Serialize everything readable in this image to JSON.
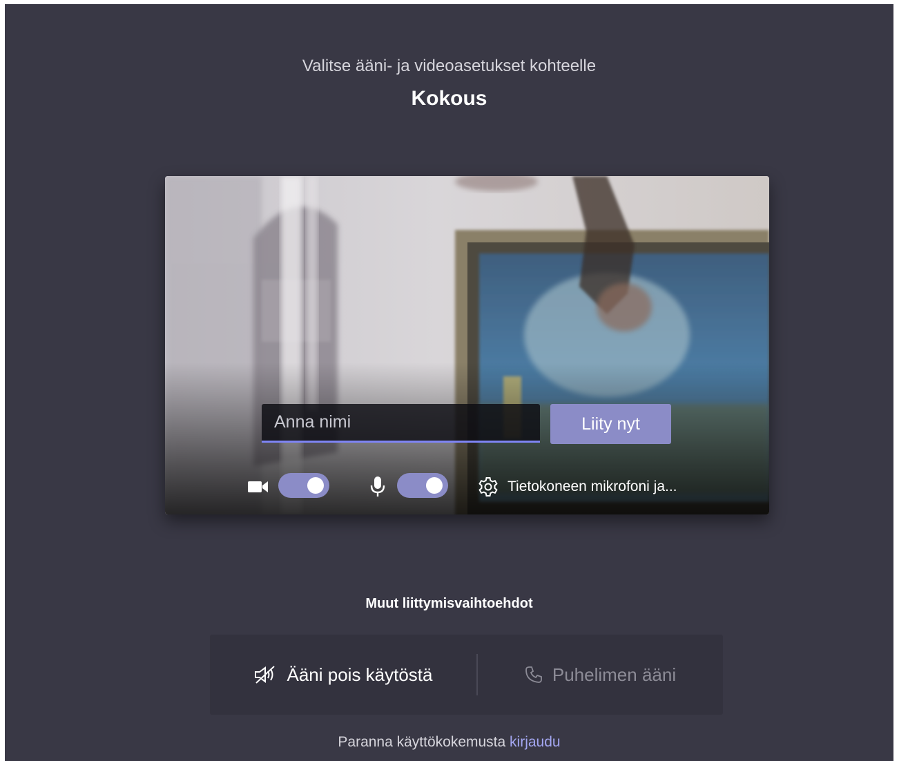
{
  "header": {
    "subtitle": "Valitse ääni- ja videoasetukset kohteelle",
    "meeting_title": "Kokous"
  },
  "preview": {
    "name_input": {
      "value": "",
      "placeholder": "Anna nimi"
    },
    "join_button_label": "Liity nyt",
    "camera_toggle": {
      "icon": "video-camera-icon",
      "on": true
    },
    "mic_toggle": {
      "icon": "microphone-icon",
      "on": true
    },
    "device_settings": {
      "icon": "gear-icon",
      "label": "Tietokoneen mikrofoni ja..."
    }
  },
  "other_options": {
    "title": "Muut liittymisvaihtoehdot",
    "audio_off": {
      "icon": "speaker-off-icon",
      "label": "Ääni pois käytöstä"
    },
    "phone_audio": {
      "icon": "phone-icon",
      "label": "Puhelimen ääni",
      "enabled": false
    }
  },
  "footer": {
    "text": "Paranna käyttökokemusta",
    "link": "kirjaudu"
  },
  "colors": {
    "background": "#393845",
    "accent": "#8b8cc7",
    "input_underline": "#7f85f5",
    "link": "#a4a7f2",
    "panel": "#33323e"
  }
}
